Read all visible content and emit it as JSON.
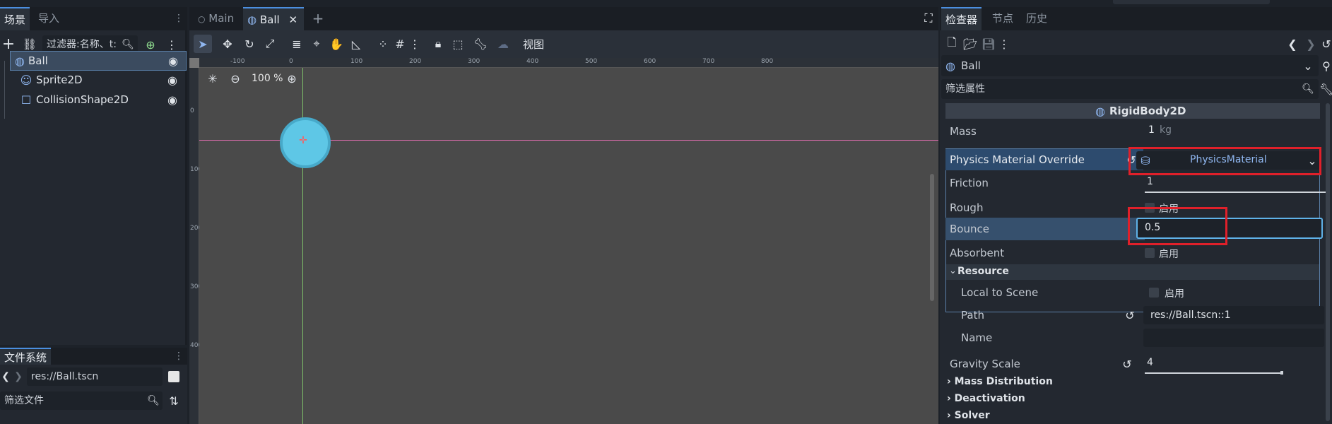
{
  "scene_dock": {
    "tabs": [
      "场景",
      "导入"
    ],
    "filter_placeholder": "过滤器:名称、t:",
    "nodes": [
      {
        "label": "Ball",
        "icon": "globe-icon"
      },
      {
        "label": "Sprite2D",
        "icon": "sprite-icon"
      },
      {
        "label": "CollisionShape2D",
        "icon": "square-icon"
      }
    ]
  },
  "fs_dock": {
    "title": "文件系统",
    "path": "res://Ball.tscn",
    "filter_placeholder": "筛选文件"
  },
  "editor_tabs": {
    "tabs": [
      "Main",
      "Ball"
    ],
    "view_menu": "视图",
    "zoom": "100 %"
  },
  "ruler": {
    "h_ticks": [
      "-100",
      "0",
      "100",
      "200",
      "300",
      "400",
      "500",
      "600",
      "700",
      "800"
    ],
    "v_ticks": [
      "0",
      "100",
      "200",
      "300",
      "400"
    ]
  },
  "inspector": {
    "tabs": [
      "检查器",
      "节点",
      "历史"
    ],
    "object_name": "Ball",
    "filter_placeholder": "筛选属性",
    "section": "RigidBody2D",
    "mass_label": "Mass",
    "mass_value": "1",
    "mass_unit": "kg",
    "pmo_label": "Physics Material Override",
    "pmo_value": "PhysicsMaterial",
    "friction_label": "Friction",
    "friction_value": "1",
    "rough_label": "Rough",
    "rough_value": "启用",
    "bounce_label": "Bounce",
    "bounce_value": "0.5",
    "absorbent_label": "Absorbent",
    "absorbent_value": "启用",
    "resource_label": "Resource",
    "local_label": "Local to Scene",
    "local_value": "启用",
    "path_label": "Path",
    "path_value": "res://Ball.tscn::1",
    "name_label": "Name",
    "gravity_label": "Gravity Scale",
    "gravity_value": "4",
    "groups": [
      "Mass Distribution",
      "Deactivation",
      "Solver"
    ]
  },
  "colors": {
    "accent": "#4b8fe0",
    "highlight": "#e0202a",
    "ball": "#5ec7e6"
  }
}
